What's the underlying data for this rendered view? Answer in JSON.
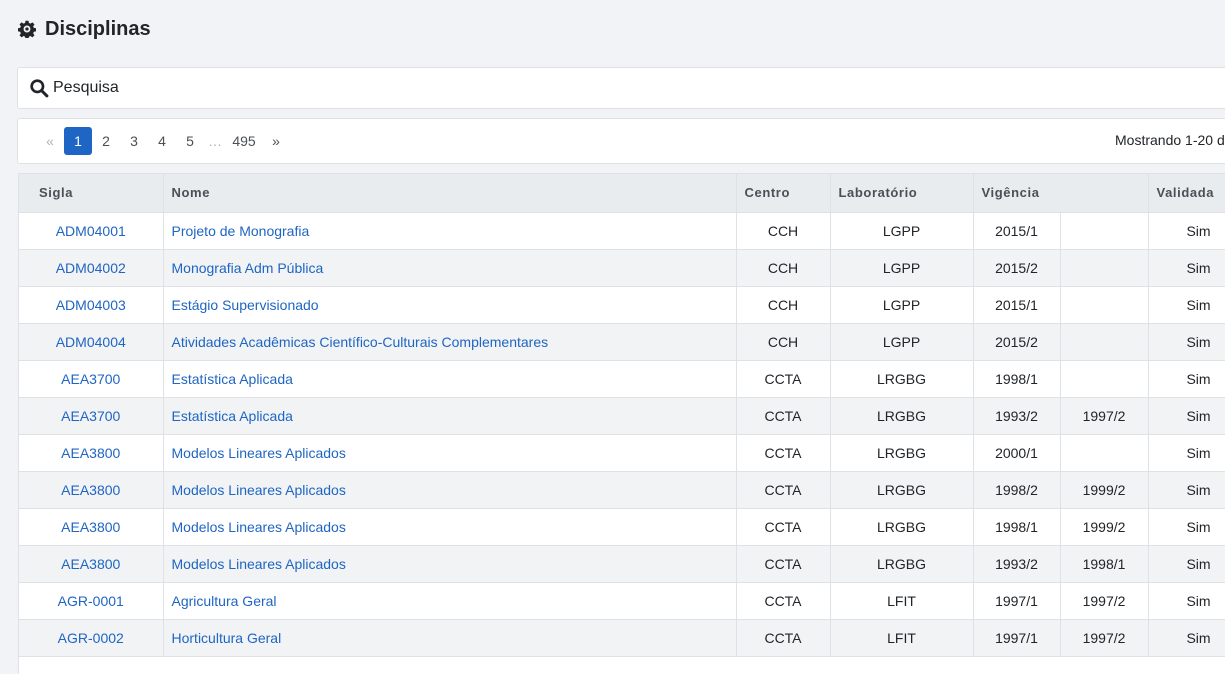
{
  "header": {
    "title": "Disciplinas",
    "icon": "cog-icon"
  },
  "search": {
    "placeholder": "Pesquisa",
    "value": "",
    "icon": "search-icon"
  },
  "pagination": {
    "prev": "«",
    "pages": [
      "1",
      "2",
      "3",
      "4",
      "5"
    ],
    "ellipsis": "…",
    "last": "495",
    "next": "»",
    "active_page": "1",
    "showing": "Mostrando 1-20 d"
  },
  "table": {
    "headers": {
      "sigla": "Sigla",
      "nome": "Nome",
      "centro": "Centro",
      "laboratorio": "Laboratório",
      "vigencia": "Vigência",
      "validada": "Validada"
    },
    "rows": [
      {
        "sigla": "ADM04001",
        "nome": "Projeto de Monografia",
        "centro": "CCH",
        "laboratorio": "LGPP",
        "inicio": "2015/1",
        "fim": "",
        "validada": "Sim"
      },
      {
        "sigla": "ADM04002",
        "nome": "Monografia Adm Pública",
        "centro": "CCH",
        "laboratorio": "LGPP",
        "inicio": "2015/2",
        "fim": "",
        "validada": "Sim"
      },
      {
        "sigla": "ADM04003",
        "nome": "Estágio Supervisionado",
        "centro": "CCH",
        "laboratorio": "LGPP",
        "inicio": "2015/1",
        "fim": "",
        "validada": "Sim"
      },
      {
        "sigla": "ADM04004",
        "nome": "Atividades Acadêmicas Científico-Culturais Complementares",
        "centro": "CCH",
        "laboratorio": "LGPP",
        "inicio": "2015/2",
        "fim": "",
        "validada": "Sim"
      },
      {
        "sigla": "AEA3700",
        "nome": "Estatística Aplicada",
        "centro": "CCTA",
        "laboratorio": "LRGBG",
        "inicio": "1998/1",
        "fim": "",
        "validada": "Sim"
      },
      {
        "sigla": "AEA3700",
        "nome": "Estatística Aplicada",
        "centro": "CCTA",
        "laboratorio": "LRGBG",
        "inicio": "1993/2",
        "fim": "1997/2",
        "validada": "Sim"
      },
      {
        "sigla": "AEA3800",
        "nome": "Modelos Lineares Aplicados",
        "centro": "CCTA",
        "laboratorio": "LRGBG",
        "inicio": "2000/1",
        "fim": "",
        "validada": "Sim"
      },
      {
        "sigla": "AEA3800",
        "nome": "Modelos Lineares Aplicados",
        "centro": "CCTA",
        "laboratorio": "LRGBG",
        "inicio": "1998/2",
        "fim": "1999/2",
        "validada": "Sim"
      },
      {
        "sigla": "AEA3800",
        "nome": "Modelos Lineares Aplicados",
        "centro": "CCTA",
        "laboratorio": "LRGBG",
        "inicio": "1998/1",
        "fim": "1999/2",
        "validada": "Sim"
      },
      {
        "sigla": "AEA3800",
        "nome": "Modelos Lineares Aplicados",
        "centro": "CCTA",
        "laboratorio": "LRGBG",
        "inicio": "1993/2",
        "fim": "1998/1",
        "validada": "Sim"
      },
      {
        "sigla": "AGR-0001",
        "nome": "Agricultura Geral",
        "centro": "CCTA",
        "laboratorio": "LFIT",
        "inicio": "1997/1",
        "fim": "1997/2",
        "validada": "Sim"
      },
      {
        "sigla": "AGR-0002",
        "nome": "Horticultura Geral",
        "centro": "CCTA",
        "laboratorio": "LFIT",
        "inicio": "1997/1",
        "fim": "1997/2",
        "validada": "Sim"
      }
    ]
  },
  "colors": {
    "link": "#1f65c3",
    "active_page": "#1f65c3",
    "background": "#f1f3f6"
  }
}
